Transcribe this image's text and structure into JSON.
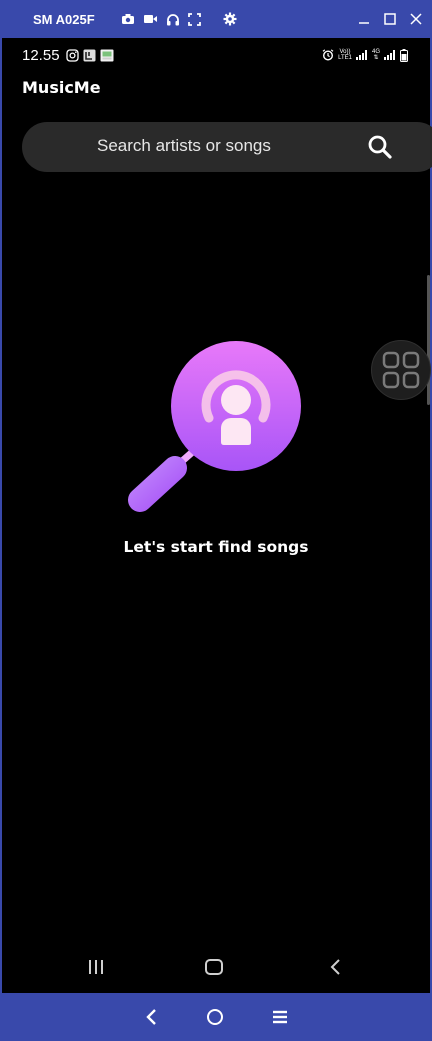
{
  "window": {
    "device_name": "SM A025F",
    "toolbar_icons": [
      "camera-icon",
      "video-icon",
      "headphones-icon",
      "fullscreen-icon",
      "settings-icon"
    ],
    "controls": [
      "minimize-icon",
      "maximize-icon",
      "close-icon"
    ],
    "accent_color": "#3949ab"
  },
  "status_bar": {
    "time": "12.55",
    "left_icons": [
      "instagram-icon",
      "app-icon",
      "image-icon"
    ],
    "right_icons": [
      "alarm-icon",
      "volte-icon",
      "signal-icon",
      "4g-icon",
      "signal-icon-2",
      "battery-icon"
    ],
    "volte_label": "Vo))",
    "lte_label": "LTE1",
    "net_label": "4G"
  },
  "app": {
    "title": "MusicMe",
    "search": {
      "placeholder": "Search artists or songs"
    },
    "empty_state": {
      "message": "Let's start find songs",
      "icon": "search-podcast-icon",
      "gradient": [
        "#e879f9",
        "#a855f7"
      ]
    }
  },
  "android_nav": {
    "buttons": [
      "recents-icon",
      "home-icon",
      "back-icon"
    ]
  },
  "host_nav": {
    "buttons": [
      "back-icon",
      "home-icon",
      "menu-icon"
    ]
  }
}
